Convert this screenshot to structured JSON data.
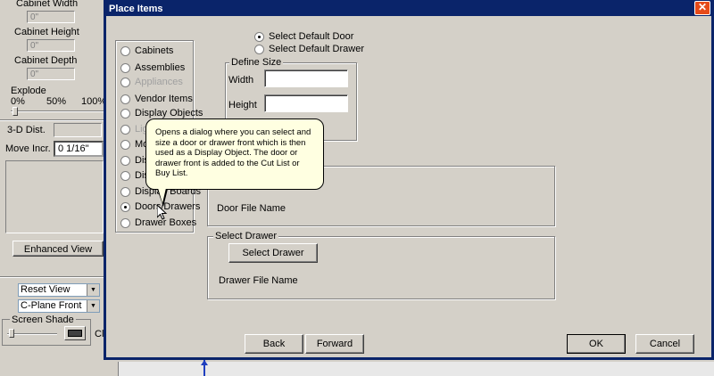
{
  "side_panel": {
    "cabinet_width_label": "Cabinet Width",
    "cabinet_width_value": "0\"",
    "cabinet_height_label": "Cabinet Height",
    "cabinet_height_value": "0\"",
    "cabinet_depth_label": "Cabinet Depth",
    "cabinet_depth_value": "0\"",
    "explode_label": "Explode",
    "explode_ticks": [
      "0%",
      "50%",
      "100%"
    ],
    "dist_3d_label": "3-D Dist.",
    "move_incr_label": "Move Incr.",
    "move_incr_value": "0 1/16\"",
    "enhanced_view_label": "Enhanced View",
    "view_select": "Reset View",
    "plane_select": "C-Plane Front",
    "screen_shade_label": "Screen Shade",
    "cut_off_text": "Cl"
  },
  "dialog": {
    "title": "Place Items",
    "close_glyph": "✕",
    "categories": [
      {
        "label": "Cabinets",
        "selected": false,
        "disabled": false
      },
      {
        "label": "Assemblies",
        "selected": false,
        "disabled": false
      },
      {
        "label": "Appliances",
        "selected": false,
        "disabled": true
      },
      {
        "label": "Vendor Items",
        "selected": false,
        "disabled": false
      },
      {
        "label": "Display Objects",
        "selected": false,
        "disabled": false
      },
      {
        "label": "Lig",
        "selected": false,
        "disabled": true
      },
      {
        "label": "Mol",
        "selected": false,
        "disabled": false
      },
      {
        "label": "Dis",
        "selected": false,
        "disabled": false
      },
      {
        "label": "Dis",
        "selected": false,
        "disabled": false
      },
      {
        "label": "Display Boards",
        "selected": false,
        "disabled": false
      },
      {
        "label": "Doors/Drawers",
        "selected": true,
        "disabled": false
      },
      {
        "label": "Drawer Boxes",
        "selected": false,
        "disabled": false
      }
    ],
    "select_default_door": "Select Default Door",
    "select_default_drawer": "Select Default Drawer",
    "define_size_title": "Define Size",
    "width_label": "Width",
    "height_label": "Height",
    "door_file_name_label": "Door File Name",
    "select_drawer_group_title": "Select Drawer",
    "select_drawer_button": "Select Drawer",
    "drawer_file_name_label": "Drawer File Name",
    "back_button": "Back",
    "forward_button": "Forward",
    "ok_button": "OK",
    "cancel_button": "Cancel"
  },
  "tooltip": {
    "text": "Opens a dialog where you can select and size a door or drawer front which is then used as a Display Object. The door or drawer front is added to the Cut List or Buy List."
  },
  "colors": {
    "titlebar": "#0a246a",
    "window_bg": "#d4d0c8",
    "tooltip_bg": "#ffffe1",
    "close_button": "#e64a19"
  }
}
